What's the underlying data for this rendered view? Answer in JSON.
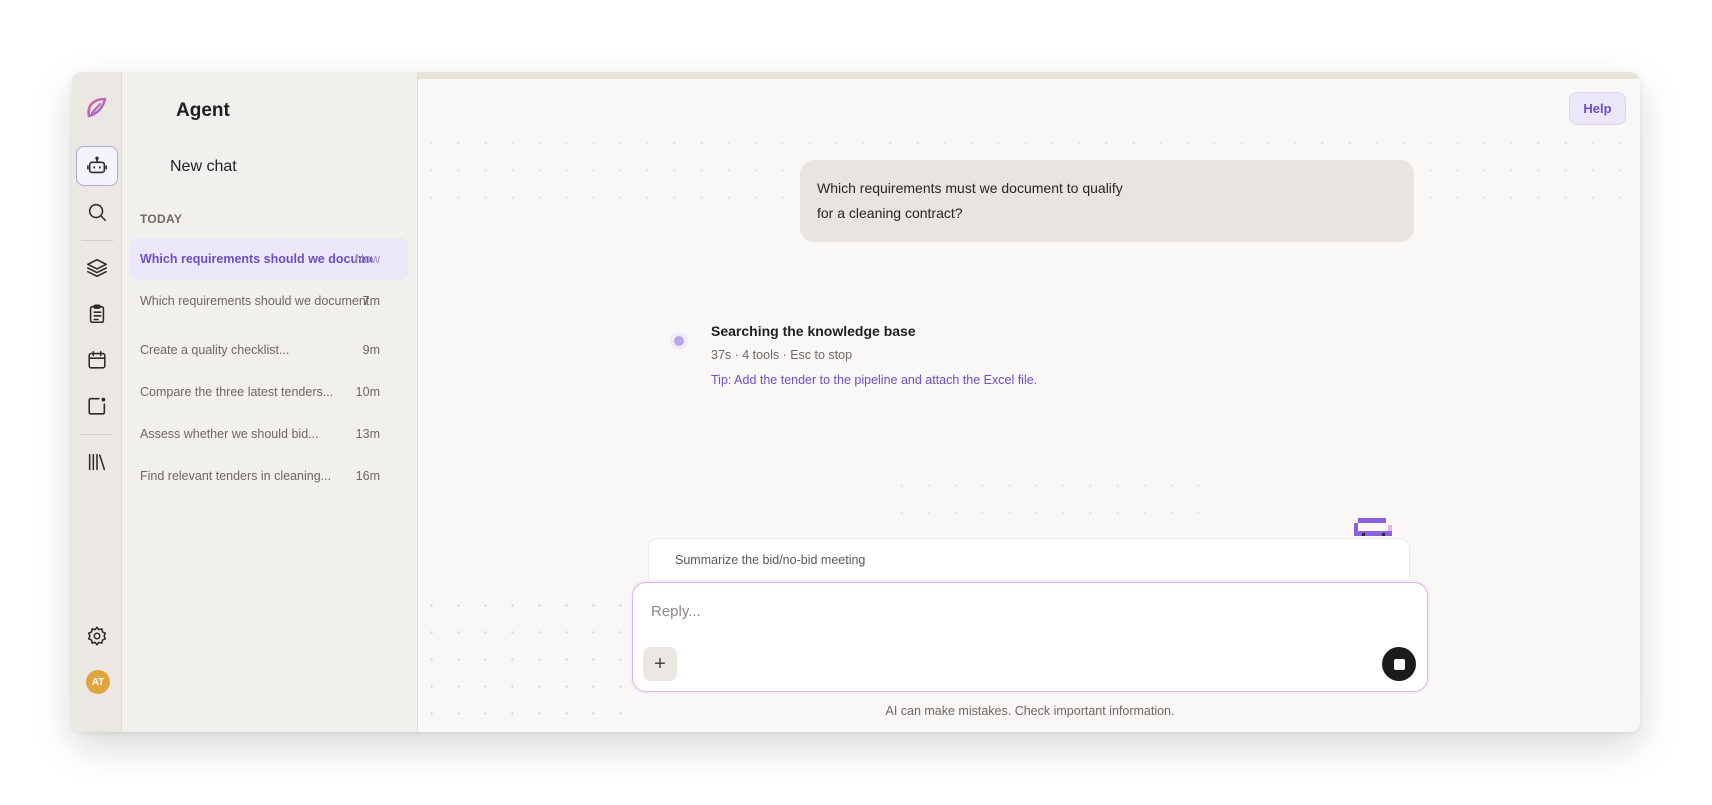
{
  "rail": {
    "icons": [
      "logo-icon",
      "robot-icon",
      "search-icon",
      "layers-icon",
      "clipboard-icon",
      "calendar-icon",
      "note-icon",
      "library-icon",
      "gear-icon"
    ],
    "avatar_initials": "AT",
    "accent": "#6b4fc4"
  },
  "sidebar": {
    "title": "Agent",
    "new_chat": "New chat",
    "section": "TODAY",
    "chats": [
      {
        "title": "Which requirements should we document...",
        "time": "Now",
        "active": true
      },
      {
        "title": "Which requirements should we document...",
        "time": "7m",
        "active": false
      },
      {
        "title": "Create a quality checklist...",
        "time": "9m",
        "active": false
      },
      {
        "title": "Compare the three latest tenders...",
        "time": "10m",
        "active": false
      },
      {
        "title": "Assess whether we should bid...",
        "time": "13m",
        "active": false
      },
      {
        "title": "Find relevant tenders in cleaning...",
        "time": "16m",
        "active": false
      }
    ]
  },
  "header": {
    "help_label": "Help"
  },
  "conversation": {
    "user_message_line1": "Which requirements must we document to qualify",
    "user_message_line2": "for a cleaning contract?",
    "status_title": "Searching the knowledge base",
    "status_meta": "37s · 4 tools · Esc to stop",
    "status_tip": "Tip: Add the tender to the pipeline and attach the Excel file."
  },
  "composer": {
    "suggestion": "Summarize the bid/no-bid meeting",
    "placeholder": "Reply...",
    "disclaimer": "AI can make mistakes. Check important information."
  }
}
